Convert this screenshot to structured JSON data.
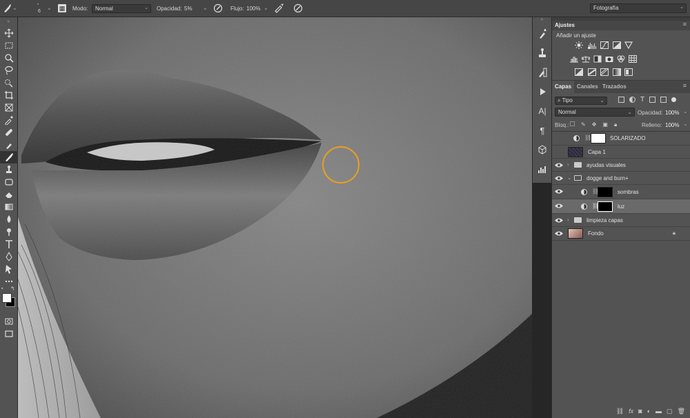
{
  "options_bar": {
    "brush_size": "6",
    "mode_label": "Modo:",
    "mode_value": "Normal",
    "opacity_label": "Opacidad:",
    "opacity_value": "5%",
    "flow_label": "Flujo:",
    "flow_value": "100%",
    "workspace": "Fotografía"
  },
  "adjustments_panel": {
    "title": "Ajustes",
    "subtitle": "Añadir un ajuste"
  },
  "layers_panel": {
    "tabs": [
      "Capas",
      "Canales",
      "Trazados"
    ],
    "filter_kind": "Tipo",
    "blend_mode": "Normal",
    "opacity_label": "Opacidad:",
    "opacity_value": "100%",
    "lock_label": "Bloq.:",
    "fill_label": "Relleno:",
    "fill_value": "100%",
    "layers": [
      {
        "name": "SOLARIZADO",
        "type": "adjustment-curves",
        "visible": false
      },
      {
        "name": "Capa 1",
        "type": "pixel",
        "visible": false
      },
      {
        "name": "ayudas visuales",
        "type": "group",
        "visible": true
      },
      {
        "name": "dogge and burn+",
        "type": "group-open",
        "visible": true
      },
      {
        "name": "sombras",
        "type": "adjustment-curves",
        "visible": true
      },
      {
        "name": "luz",
        "type": "adjustment-curves",
        "visible": true,
        "selected": true
      },
      {
        "name": "limpieza capas",
        "type": "group",
        "visible": true
      },
      {
        "name": "Fondo",
        "type": "background",
        "visible": true
      }
    ]
  },
  "colors": {
    "chrome": "#535353",
    "options_bar": "#464646",
    "selected_layer": "#6a6a6a",
    "brush_cursor": "#e8a020"
  }
}
